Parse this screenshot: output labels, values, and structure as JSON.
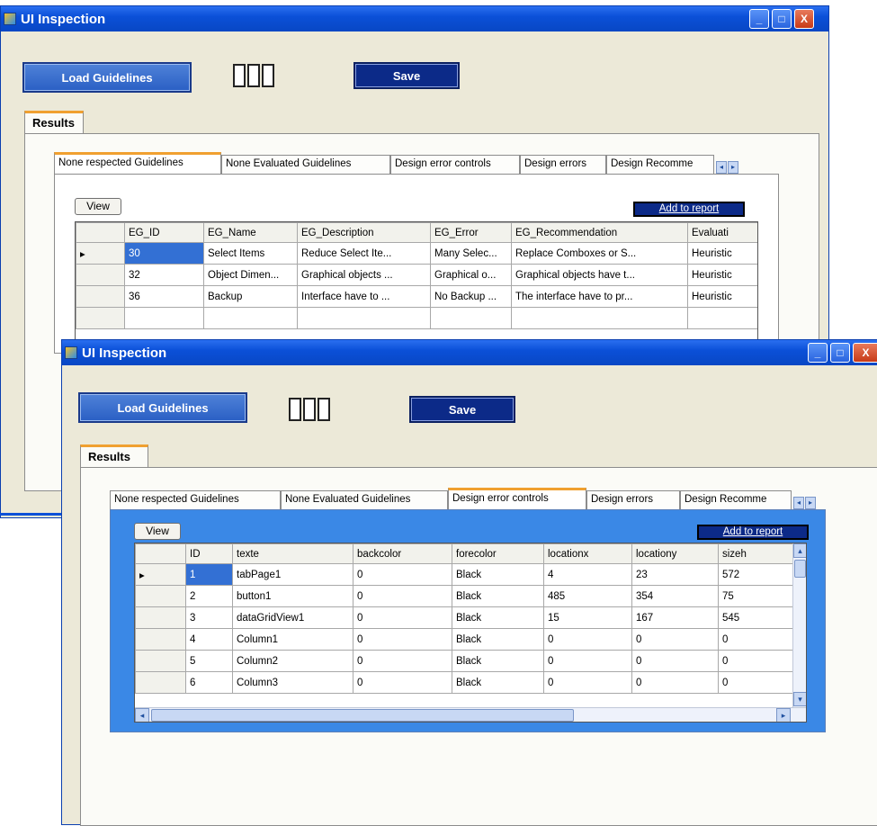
{
  "window": {
    "title": "UI Inspection",
    "min": "_",
    "max": "□",
    "close": "X"
  },
  "toolbar": {
    "load_label": "Load Guidelines",
    "save_label": "Save"
  },
  "results_tab": "Results",
  "tabs": [
    "None respected Guidelines",
    "None Evaluated Guidelines",
    "Design error controls",
    "Design errors",
    "Design Recomme"
  ],
  "tab_scroll": {
    "left": "◂",
    "right": "▸"
  },
  "view_label": "View",
  "add_label": "Add to report",
  "back_grid": {
    "columns": [
      "EG_ID",
      "EG_Name",
      "EG_Description",
      "EG_Error",
      "EG_Recommendation",
      "Evaluati"
    ],
    "rows": [
      [
        "30",
        "Select Items",
        "Reduce Select Ite...",
        "Many Selec...",
        "Replace Comboxes or S...",
        "Heuristic"
      ],
      [
        "32",
        "Object Dimen...",
        "Graphical objects ...",
        "Graphical o...",
        "Graphical objects have t...",
        "Heuristic"
      ],
      [
        "36",
        "Backup",
        "Interface have to ...",
        "No Backup ...",
        "The interface have to pr...",
        "Heuristic"
      ]
    ]
  },
  "front_grid": {
    "columns": [
      "ID",
      "texte",
      "backcolor",
      "forecolor",
      "locationx",
      "locationy",
      "sizeh"
    ],
    "rows": [
      [
        "1",
        "tabPage1",
        "0",
        "Black",
        "4",
        "23",
        "572"
      ],
      [
        "2",
        "button1",
        "0",
        "Black",
        "485",
        "354",
        "75"
      ],
      [
        "3",
        "dataGridView1",
        "0",
        "Black",
        "15",
        "167",
        "545"
      ],
      [
        "4",
        "Column1",
        "0",
        "Black",
        "0",
        "0",
        "0"
      ],
      [
        "5",
        "Column2",
        "0",
        "Black",
        "0",
        "0",
        "0"
      ],
      [
        "6",
        "Column3",
        "0",
        "Black",
        "0",
        "0",
        "0"
      ]
    ]
  },
  "row_pointer": "▸",
  "scroll": {
    "up": "▴",
    "down": "▾",
    "left": "◂",
    "right": "▸"
  },
  "colors": {
    "titlebar": "#0b50d8",
    "window_bg": "#ece9d8",
    "selected_cell": "#3370d4",
    "tab_accent": "#f0a030",
    "front_panel": "#3a88e6"
  }
}
